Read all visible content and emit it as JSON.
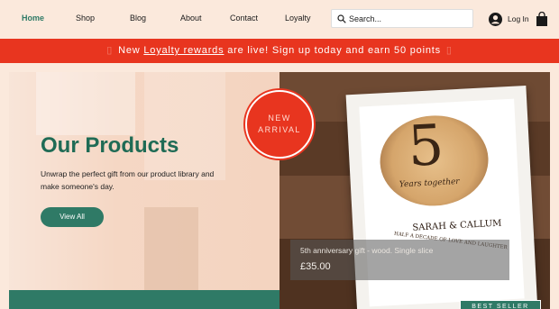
{
  "nav": {
    "items": [
      {
        "label": "Home",
        "active": true
      },
      {
        "label": "Shop"
      },
      {
        "label": "Blog"
      },
      {
        "label": "About"
      },
      {
        "label": "Contact"
      },
      {
        "label": "Loyalty"
      }
    ]
  },
  "search": {
    "placeholder": "Search..."
  },
  "account": {
    "login_label": "Log In",
    "login_icon": "user-avatar-icon",
    "cart_icon": "shopping-bag-icon"
  },
  "banner": {
    "prefix": "New",
    "link_text": "Loyalty rewards",
    "suffix": "are live! Sign up today and earn 50 points",
    "color": "#e8351f"
  },
  "hero": {
    "title": "Our Products",
    "subtitle": "Unwrap the perfect gift from our product library and make someone's day.",
    "button_label": "View All",
    "accent": "#2f7a66"
  },
  "product": {
    "badge_line1": "NEW",
    "badge_line2": "ARRIVAL",
    "name": "5th anniversary gift - wood. Single slice",
    "price": "£35.00",
    "artwork": {
      "number": "5",
      "caption": "Years together",
      "names": "SARAH & CALLUM",
      "verse": "HALF A DECADE OF LOVE AND LAUGHTER"
    }
  },
  "best_seller_label": "BEST SELLER"
}
